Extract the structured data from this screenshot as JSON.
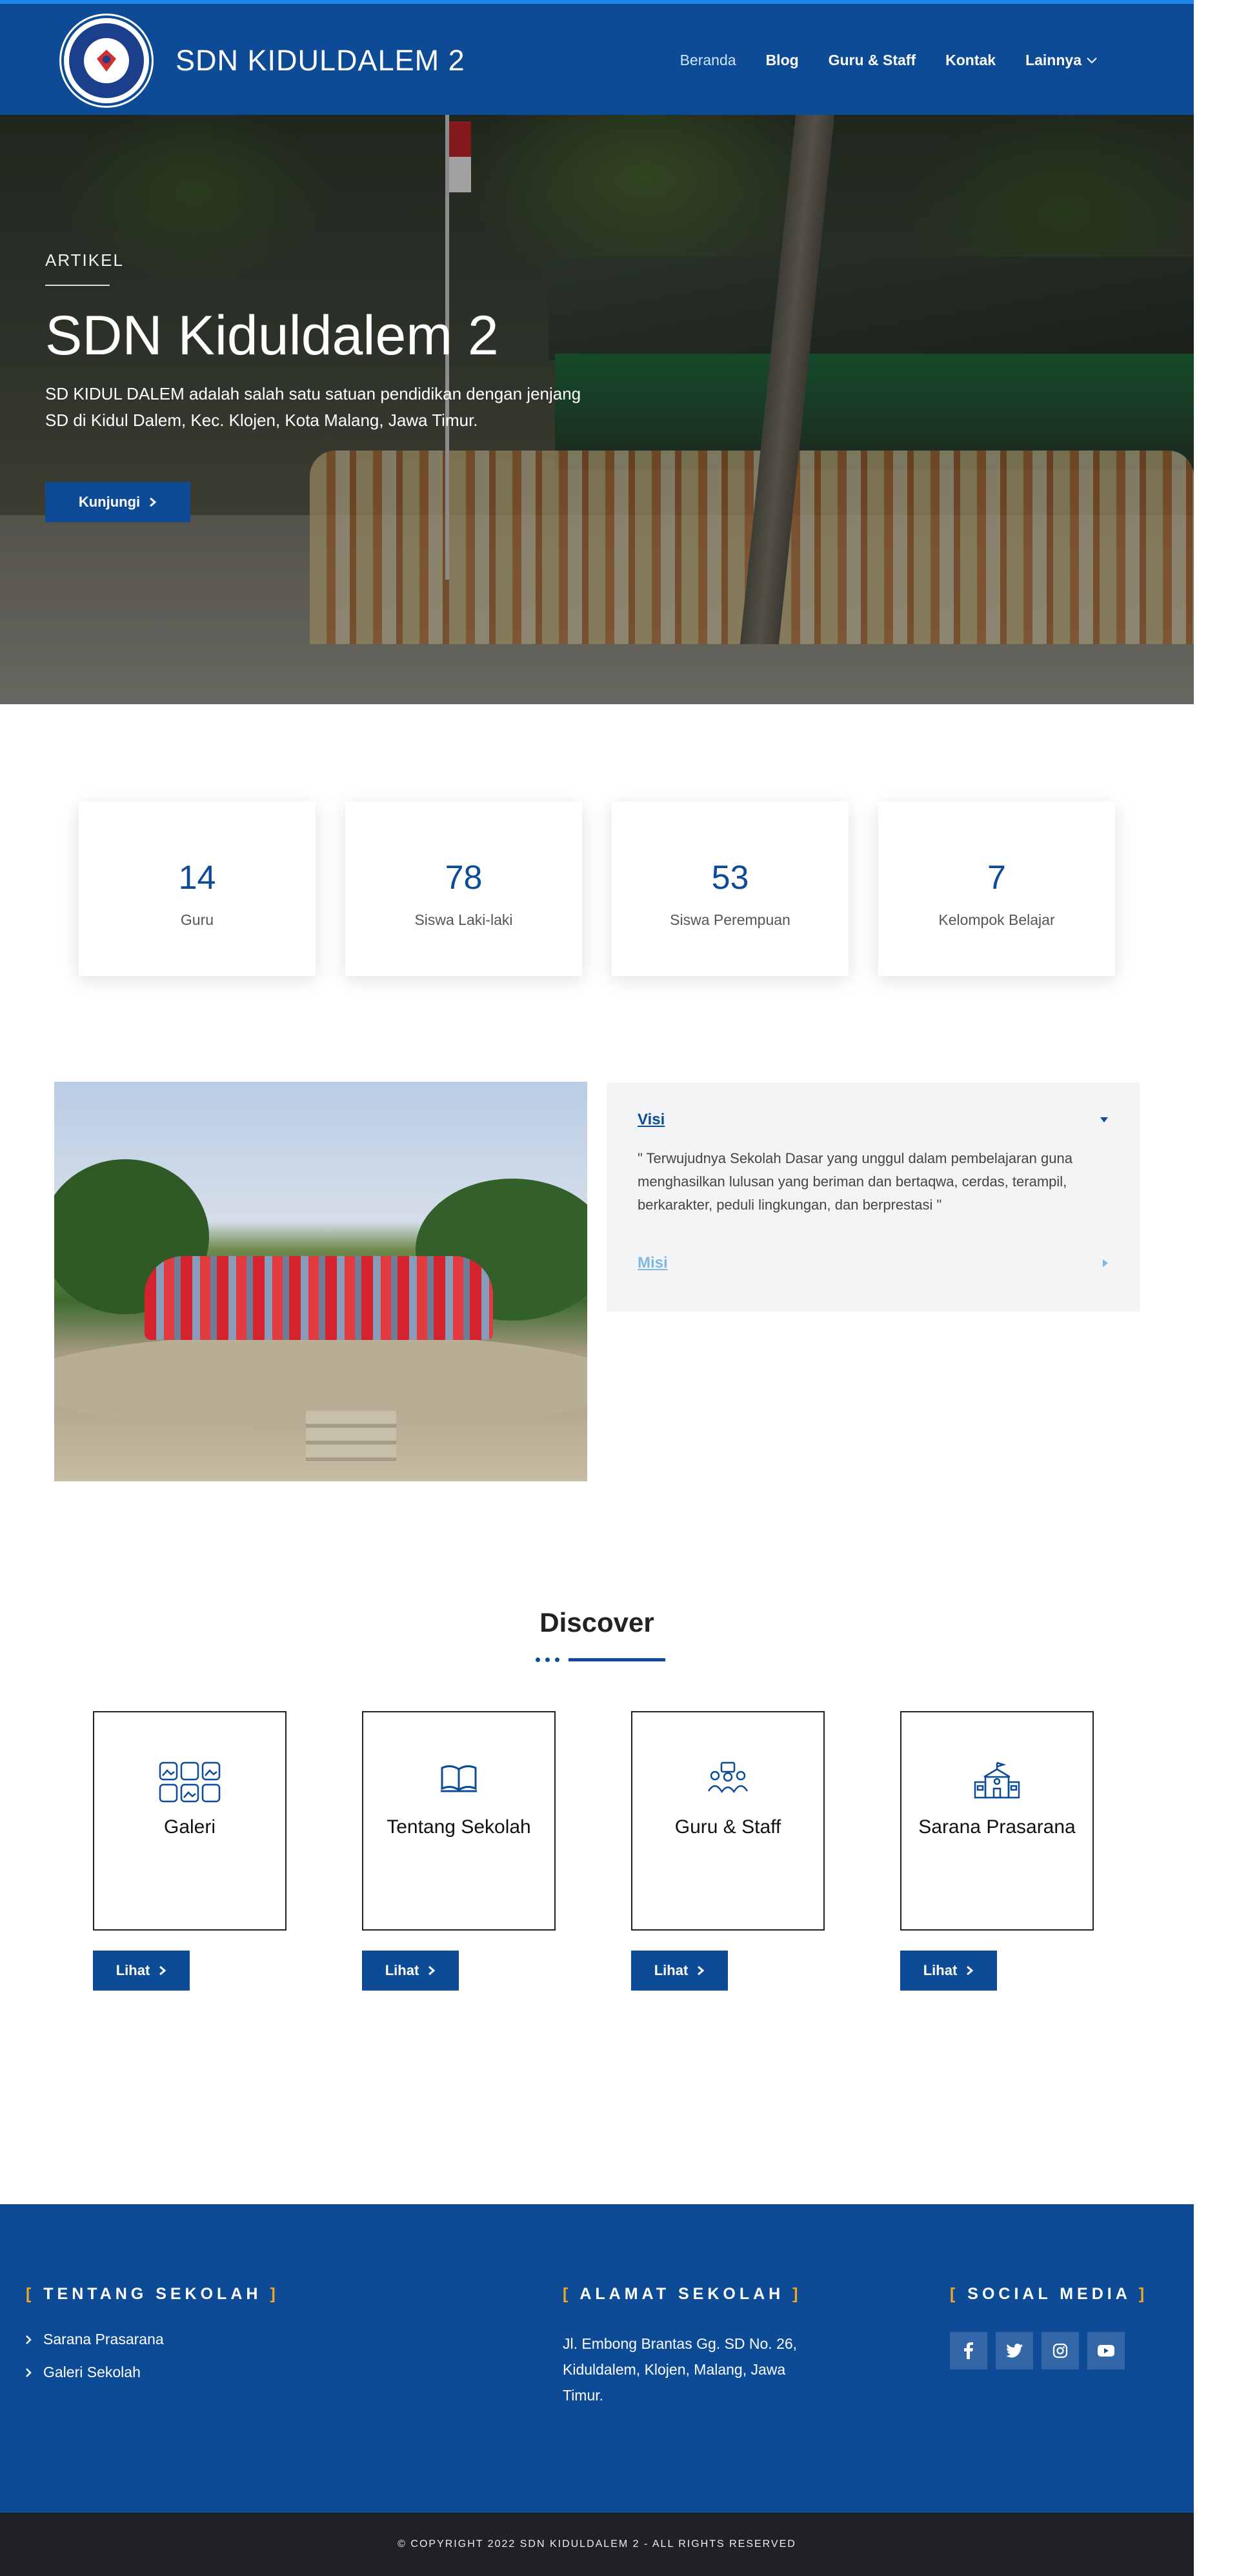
{
  "header": {
    "site_title": "SDN KIDULDALEM 2",
    "nav": [
      {
        "label": "Beranda",
        "active": true
      },
      {
        "label": "Blog"
      },
      {
        "label": "Guru & Staff"
      },
      {
        "label": "Kontak"
      },
      {
        "label": "Lainnya",
        "icon": "chevron-down-icon"
      }
    ]
  },
  "hero": {
    "eyebrow": "ARTIKEL",
    "title": "SDN Kiduldalem 2",
    "text": "SD KIDUL DALEM adalah salah satu satuan pendidikan dengan jenjang SD di Kidul Dalem, Kec. Klojen, Kota Malang, Jawa Timur.",
    "button_label": "Kunjungi"
  },
  "stats": [
    {
      "value": "14",
      "label": "Guru"
    },
    {
      "value": "78",
      "label": "Siswa Laki-laki"
    },
    {
      "value": "53",
      "label": "Siswa Perempuan"
    },
    {
      "value": "7",
      "label": "Kelompok Belajar"
    }
  ],
  "accordion": {
    "visi_title": "Visi",
    "visi_body": "\" Terwujudnya Sekolah Dasar yang unggul dalam pembelajaran guna menghasilkan lulusan yang beriman dan bertaqwa, cerdas, terampil, berkarakter, peduli lingkungan, dan berprestasi \"",
    "misi_title": "Misi"
  },
  "discover": {
    "title": "Discover",
    "cards": [
      {
        "title": "Galeri",
        "icon": "gallery-icon",
        "button": "Lihat"
      },
      {
        "title": "Tentang Sekolah",
        "icon": "book-icon",
        "button": "Lihat"
      },
      {
        "title": "Guru & Staff",
        "icon": "people-icon",
        "button": "Lihat"
      },
      {
        "title": "Sarana Prasarana",
        "icon": "school-building-icon",
        "button": "Lihat"
      }
    ]
  },
  "footer": {
    "about_heading": "TENTANG SEKOLAH",
    "about_links": [
      "Sarana Prasarana",
      "Galeri Sekolah"
    ],
    "address_heading": "ALAMAT SEKOLAH",
    "address": "Jl. Embong Brantas Gg. SD No. 26, Kiduldalem, Klojen, Malang, Jawa Timur.",
    "social_heading": "SOCIAL MEDIA",
    "socials": [
      "facebook-icon",
      "twitter-icon",
      "instagram-icon",
      "youtube-icon"
    ],
    "copyright": "© COPYRIGHT 2022 SDN KIDULDALEM 2 - ALL RIGHTS RESERVED"
  },
  "colors": {
    "primary": "#0d4b97",
    "accent_bracket": "#f4a623",
    "footer_bottom": "#1f2126"
  }
}
